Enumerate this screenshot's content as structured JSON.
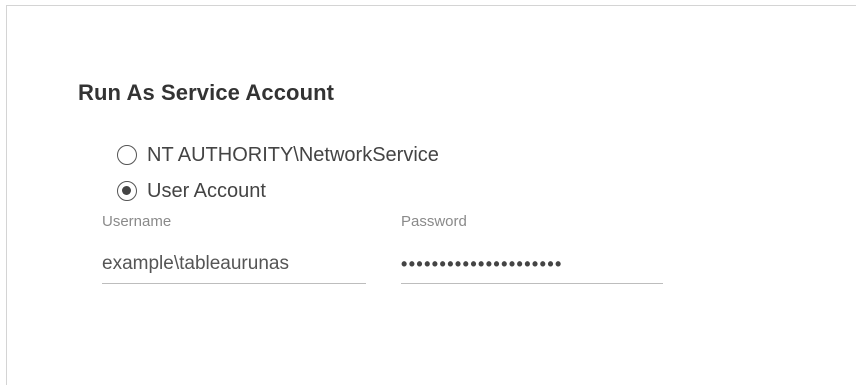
{
  "section": {
    "title": "Run As Service Account"
  },
  "options": [
    {
      "label": "NT AUTHORITY\\NetworkService",
      "selected": false
    },
    {
      "label": "User Account",
      "selected": true
    }
  ],
  "username": {
    "label": "Username",
    "value": "example\\tableaurunas"
  },
  "password": {
    "label": "Password",
    "value": "•••••••••••••••••••••"
  }
}
